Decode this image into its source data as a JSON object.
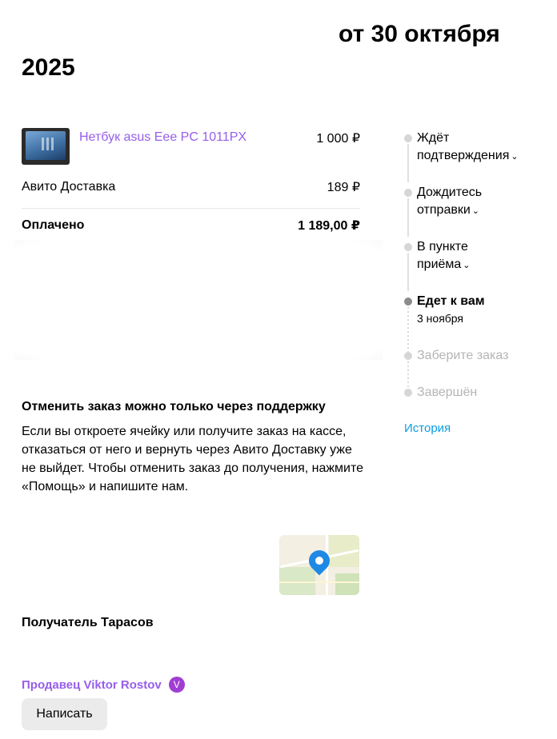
{
  "header": {
    "title_line1": "от 30 октября",
    "title_line2": "2025"
  },
  "order": {
    "item_name": "Нетбук asus Eee PC 1011PX",
    "item_price": "1 000 ₽",
    "delivery_label": "Авито Доставка",
    "delivery_price": "189 ₽",
    "paid_label": "Оплачено",
    "paid_total": "1 189,00 ₽"
  },
  "cancel": {
    "title": "Отменить заказ можно только через поддержку",
    "text": "Если вы откроете ячейку или получите заказ на кассе, отказаться от него и вернуть через Авито Доставку уже не выйдет. Чтобы отменить заказ до получения, нажмите «Помощь» и напишите нам."
  },
  "recipient": {
    "label": "Получатель Тарасов"
  },
  "seller": {
    "label": "Продавец Viktor Rostov",
    "badge": "V",
    "write_button": "Написать"
  },
  "status": {
    "steps": [
      {
        "line1": "Ждёт",
        "line2": "подтверждения",
        "expandable": true,
        "state": "done"
      },
      {
        "line1": "Дождитесь",
        "line2": "отправки",
        "expandable": true,
        "state": "done"
      },
      {
        "line1": "В пункте",
        "line2": "приёма",
        "expandable": true,
        "state": "done"
      },
      {
        "line1": "Едет к вам",
        "sub": "3 ноября",
        "state": "current"
      },
      {
        "line1": "Заберите заказ",
        "state": "pending"
      },
      {
        "line1": "Завершён",
        "state": "pending"
      }
    ],
    "history_link": "История"
  },
  "icons": {
    "chevron": "chevron-down-icon",
    "map_pin": "map-pin-icon"
  },
  "colors": {
    "accent_purple": "#965eeb",
    "link_blue": "#0a9ee1",
    "seller_badge": "#a03ed2"
  }
}
